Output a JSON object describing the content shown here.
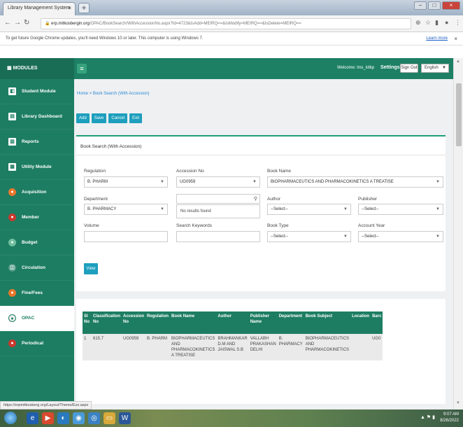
{
  "browser": {
    "tab_title": "Library Management System",
    "url_host": "erp.mitkosbergin.org",
    "url_path": "/OPAC/BookSearch/WithAccessionNo.aspx?Id=4723&IsAdd=MEIRQ==&IsModify=MEIRQ==&IsDelete=MEIRQ==",
    "infobar_text": "To get future Google Chrome updates, you'll need Windows 10 or later. This computer is using Windows 7.",
    "infobar_link": "Learn more",
    "status_url": "https://erpmitkosberg.org/Layout/Theme/Ezz.aspx"
  },
  "header": {
    "modules_title": "MODULES",
    "welcome": "Welcome: lms_kitkp",
    "settings": "Settings",
    "signout": "Sign Out",
    "language": "English"
  },
  "sidebar": {
    "items": [
      {
        "label": "Student Module",
        "icon": "student-icon"
      },
      {
        "label": "Library Dashboard",
        "icon": "dashboard-icon"
      },
      {
        "label": "Reports",
        "icon": "reports-icon"
      },
      {
        "label": "Utility Module",
        "icon": "utility-icon"
      },
      {
        "label": "Acquisition",
        "icon": "acquisition-icon"
      },
      {
        "label": "Member",
        "icon": "member-icon"
      },
      {
        "label": "Budget",
        "icon": "budget-icon"
      },
      {
        "label": "Circulation",
        "icon": "circulation-icon"
      },
      {
        "label": "Fine/Fees",
        "icon": "fine-icon"
      },
      {
        "label": "OPAC",
        "icon": "opac-icon"
      },
      {
        "label": "Periodical",
        "icon": "periodical-icon"
      }
    ]
  },
  "breadcrumb": "Home > Book Search (With Accession)",
  "toolbar": {
    "add": "Add",
    "save": "Save",
    "cancel": "Cancel",
    "exit": "Exit"
  },
  "form": {
    "title": "Book Search (With Accession)",
    "regulation_label": "Regulation",
    "regulation_value": "B. PHARM",
    "accession_label": "Accession No",
    "accession_value": "UG0959",
    "bookname_label": "Book Name",
    "bookname_value": "BIOPHARMACEUTICS AND PHARMACOKINETICS A TREATISE",
    "department_label": "Department",
    "department_value": "B. PHARMACY",
    "no_results": "No results found",
    "author_label": "Author",
    "author_value": "--Select--",
    "publisher_label": "Publisher",
    "publisher_value": "--Select--",
    "volume_label": "Volume",
    "keywords_label": "Search Keywords",
    "booktype_label": "Book Type",
    "booktype_value": "--Select--",
    "accyear_label": "Account Year",
    "accyear_value": "--Select--",
    "view_button": "View"
  },
  "results": {
    "headers": [
      "Sl No",
      "Classification No",
      "Accession No",
      "Regulation",
      "Book Name",
      "Author",
      "Publisher Name",
      "Department",
      "Book Subject",
      "Location",
      "Barc"
    ],
    "rows": [
      [
        "1",
        "615.7",
        "UG0959",
        "B. PHARM",
        "BIOPHARMACEUTICS AND PHARMACOKINETICS A TREATISE",
        "BRAHMANKAR D.M AND JAISWAL S.B",
        "VALLABH PRAKASHAN DELHI",
        "B. PHARMACY",
        "BIOPHARMACEUTICS AND PHARMACOKINETICS",
        "",
        "UG0"
      ]
    ]
  },
  "taskbar": {
    "time": "9:07 AM",
    "date": "8/26/2022"
  },
  "colors": {
    "brand_green": "#1d8064",
    "button_blue": "#1e9fbe"
  }
}
